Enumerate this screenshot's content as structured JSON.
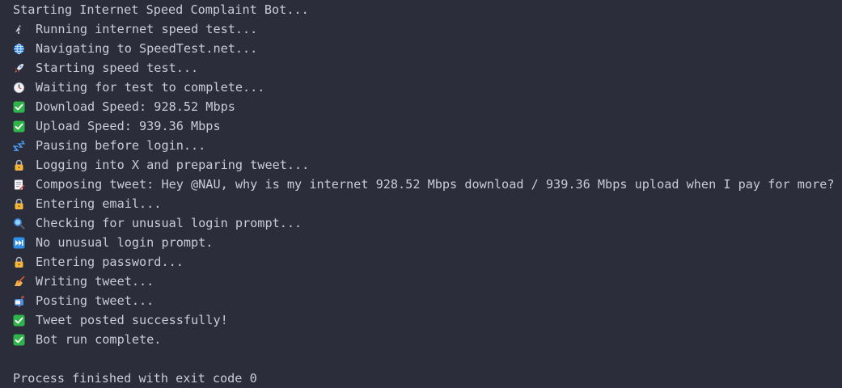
{
  "console": {
    "header": "Starting Internet Speed Complaint Bot...",
    "lines": [
      {
        "icon": "satellite-antenna-icon",
        "text": "Running internet speed test..."
      },
      {
        "icon": "globe-icon",
        "text": "Navigating to SpeedTest.net..."
      },
      {
        "icon": "rocket-icon",
        "text": "Starting speed test..."
      },
      {
        "icon": "clock-icon",
        "text": "Waiting for test to complete..."
      },
      {
        "icon": "check-mark-icon",
        "text": "Download Speed: 928.52 Mbps"
      },
      {
        "icon": "check-mark-icon",
        "text": "Upload Speed: 939.36 Mbps"
      },
      {
        "icon": "sleeping-zzz-icon",
        "text": "Pausing before login..."
      },
      {
        "icon": "lock-icon",
        "text": "Logging into X and preparing tweet..."
      },
      {
        "icon": "memo-icon",
        "text": "Composing tweet: Hey @NAU, why is my internet 928.52 Mbps download / 939.36 Mbps upload when I pay for more?"
      },
      {
        "icon": "lock-icon",
        "text": "Entering email..."
      },
      {
        "icon": "magnifying-glass-icon",
        "text": "Checking for unusual login prompt..."
      },
      {
        "icon": "fast-forward-icon",
        "text": "No unusual login prompt."
      },
      {
        "icon": "lock-icon",
        "text": "Entering password..."
      },
      {
        "icon": "writing-hand-icon",
        "text": "Writing tweet..."
      },
      {
        "icon": "mailbox-icon",
        "text": "Posting tweet..."
      },
      {
        "icon": "check-mark-icon",
        "text": "Tweet posted successfully!"
      },
      {
        "icon": "check-mark-icon",
        "text": "Bot run complete."
      }
    ],
    "footer": "Process finished with exit code 0"
  },
  "colors": {
    "background": "#2b2d3a",
    "text": "#c9ccd8",
    "check_green": "#2fb34a",
    "blue": "#2f7fd8"
  }
}
